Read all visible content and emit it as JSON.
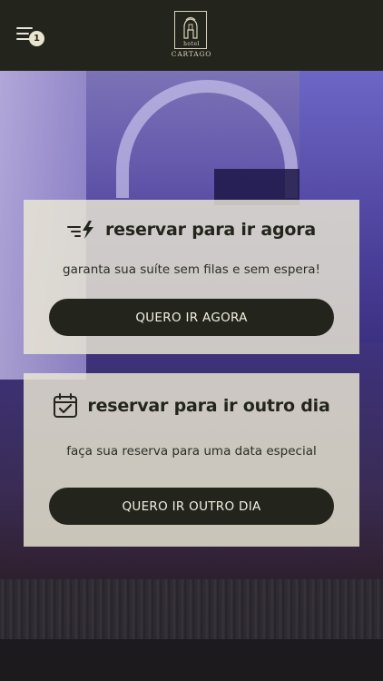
{
  "header": {
    "menu_badge": "1",
    "logo": {
      "line1": "hotel",
      "line2": "CARTAGO"
    }
  },
  "cards": {
    "now": {
      "title": "reservar para ir agora",
      "subtitle": "garanta sua suíte sem filas e sem espera!",
      "button": "QUERO IR AGORA",
      "icon": "fast-lightning-icon"
    },
    "later": {
      "title": "reservar para ir outro dia",
      "subtitle": "faça sua reserva para uma data especial",
      "button": "QUERO IR OUTRO DIA",
      "icon": "calendar-check-icon"
    }
  },
  "colors": {
    "header_bg": "#23251d",
    "card_bg": "#ece9d4",
    "button_bg": "#23251d",
    "button_text": "#f2efe0"
  }
}
